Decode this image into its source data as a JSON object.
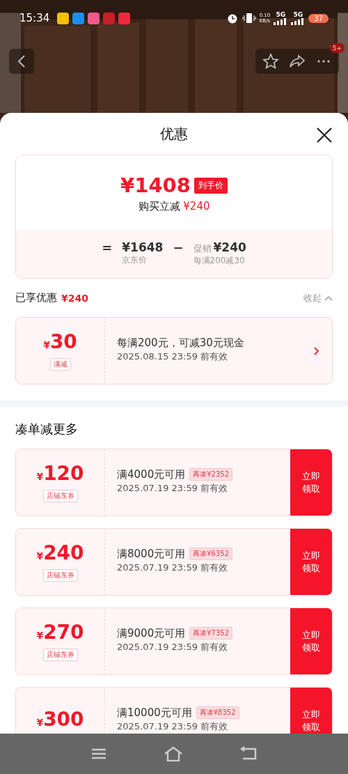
{
  "status_bar": {
    "time": "15:34",
    "network_speed": "0.10",
    "network_unit": "KB/s",
    "sim_1": "5G",
    "sim_2": "5G",
    "battery": "37"
  },
  "top_bar": {
    "more_badge": "5+"
  },
  "sheet": {
    "title": "优惠"
  },
  "summary": {
    "final_price": "¥1408",
    "final_label": "到手价",
    "instant_label": "购买立减",
    "instant_amount": "¥240",
    "equals": "=",
    "original_price": "¥1648",
    "original_label": "京东价",
    "minus": "−",
    "promo_label": "促销",
    "promo_amount": "¥240",
    "promo_rule": "每满200减30"
  },
  "applied": {
    "label": "已享优惠",
    "amount": "¥240",
    "toggle": "收起",
    "expanded": true
  },
  "applied_coupons": [
    {
      "currency": "¥",
      "amount": "30",
      "tag": "满减",
      "description": "每满200元，可减30元现金",
      "validity": "2025.08.15 23:59 前有效"
    }
  ],
  "more_title": "凑单减更多",
  "more_coupons": [
    {
      "currency": "¥",
      "amount": "120",
      "tag": "店铺东券",
      "condition": "满4000元可用",
      "gap": "再凑¥2352",
      "validity": "2025.07.19 23:59 前有效",
      "action": "立即领取"
    },
    {
      "currency": "¥",
      "amount": "240",
      "tag": "店铺东券",
      "condition": "满8000元可用",
      "gap": "再凑¥6352",
      "validity": "2025.07.19 23:59 前有效",
      "action": "立即领取"
    },
    {
      "currency": "¥",
      "amount": "270",
      "tag": "店铺东券",
      "condition": "满9000元可用",
      "gap": "再凑¥7352",
      "validity": "2025.07.19 23:59 前有效",
      "action": "立即领取"
    },
    {
      "currency": "¥",
      "amount": "300",
      "condition": "满10000元可用",
      "gap": "再凑¥8352",
      "validity": "2025.07.19 23:59 前有效",
      "action": "立即领取"
    }
  ]
}
